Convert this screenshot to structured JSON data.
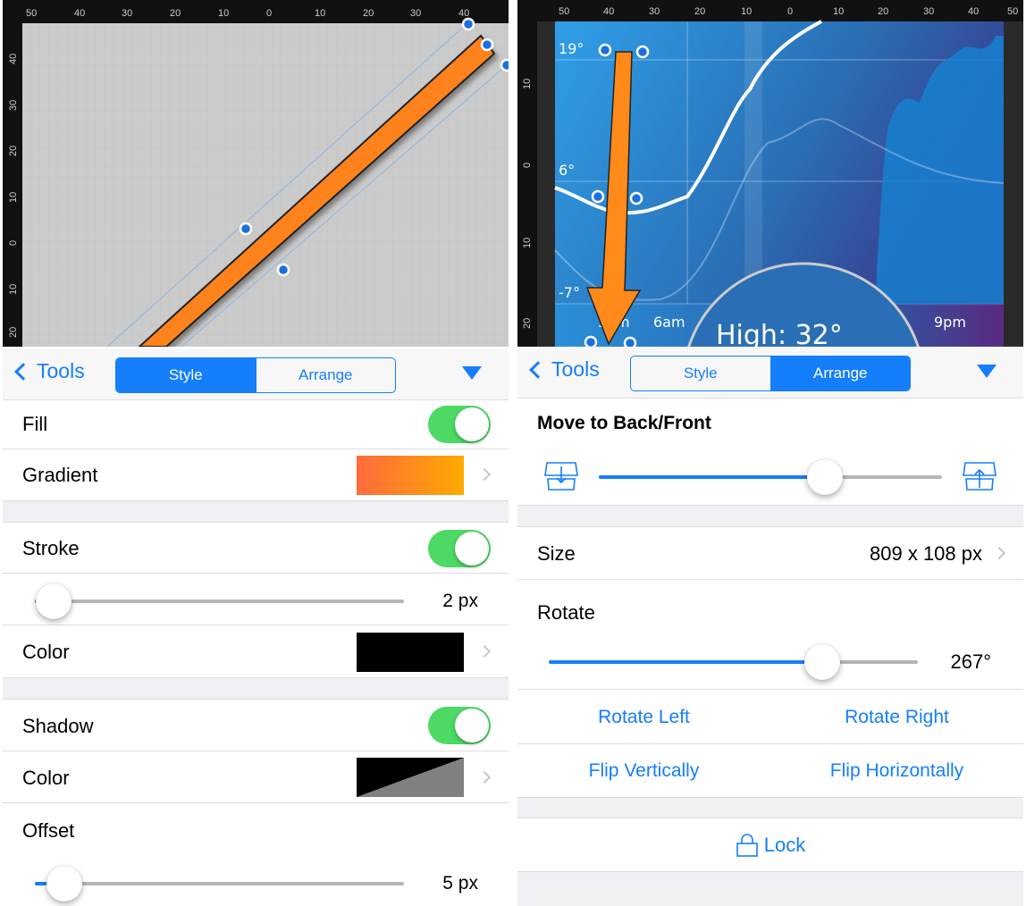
{
  "left": {
    "canvas": {
      "ruler_top": [
        "50",
        "40",
        "30",
        "20",
        "10",
        "0",
        "10",
        "20",
        "30",
        "40"
      ],
      "ruler_left": [
        "40",
        "30",
        "20",
        "10",
        "0",
        "10",
        "20"
      ],
      "shape": "orange-bar"
    },
    "toolbar": {
      "back_label": "Tools",
      "tabs": [
        "Style",
        "Arrange"
      ],
      "active_tab": "Style",
      "menu_icon": "triangle-down-icon"
    },
    "fill": {
      "label": "Fill",
      "enabled": true
    },
    "gradient": {
      "label": "Gradient",
      "colors": [
        "#ff6a3d",
        "#ffaa00"
      ]
    },
    "stroke": {
      "label": "Stroke",
      "enabled": true,
      "width_value": "2 px",
      "slider_fraction": 0.05
    },
    "stroke_color": {
      "label": "Color",
      "color": "#000000"
    },
    "shadow": {
      "label": "Shadow",
      "enabled": true
    },
    "shadow_color": {
      "label": "Color",
      "colors": [
        "#000000",
        "#808080"
      ]
    },
    "offset": {
      "label": "Offset",
      "value": "5 px",
      "slider_fraction": 0.08
    }
  },
  "right": {
    "canvas": {
      "ruler_top": [
        "50",
        "40",
        "30",
        "20",
        "10",
        "0",
        "10",
        "20",
        "30",
        "40",
        "50"
      ],
      "ruler_left": [
        "10",
        "0",
        "10",
        "20"
      ],
      "temps": [
        "19°",
        "6°",
        "-7°"
      ],
      "times": [
        "3am",
        "6am",
        "9pm"
      ],
      "high_label": "High: 32°",
      "accent": "#2b8fd9"
    },
    "toolbar": {
      "back_label": "Tools",
      "tabs": [
        "Style",
        "Arrange"
      ],
      "active_tab": "Arrange",
      "menu_icon": "triangle-down-icon"
    },
    "move": {
      "title": "Move to Back/Front",
      "slider_fraction": 0.66
    },
    "size": {
      "label": "Size",
      "value": "809 x 108 px"
    },
    "rotate": {
      "label": "Rotate",
      "value": "267°",
      "slider_fraction": 0.74
    },
    "buttons": {
      "rotate_left": "Rotate Left",
      "rotate_right": "Rotate Right",
      "flip_v": "Flip Vertically",
      "flip_h": "Flip Horizontally",
      "lock": "Lock"
    }
  }
}
